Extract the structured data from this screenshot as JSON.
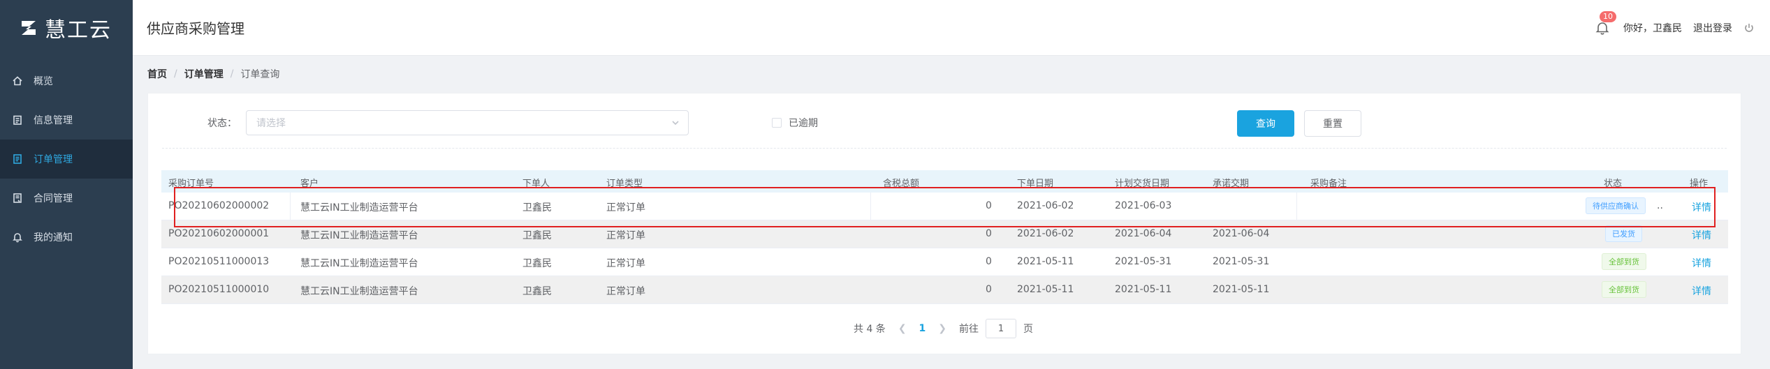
{
  "app": {
    "logo_text": "慧工云"
  },
  "sidebar": {
    "items": [
      {
        "label": "概览",
        "icon": "home-icon"
      },
      {
        "label": "信息管理",
        "icon": "clipboard-icon"
      },
      {
        "label": "订单管理",
        "icon": "order-icon",
        "active": true
      },
      {
        "label": "合同管理",
        "icon": "contract-icon"
      },
      {
        "label": "我的通知",
        "icon": "bell-icon"
      }
    ]
  },
  "header": {
    "title": "供应商采购管理",
    "notification_count": "10",
    "greeting": "你好，卫鑫民",
    "logout_label": "退出登录"
  },
  "breadcrumb": {
    "home": "首页",
    "section": "订单管理",
    "current": "订单查询",
    "separator": "/"
  },
  "filters": {
    "status_label": "状态：",
    "status_placeholder": "请选择",
    "overdue_label": "已逾期",
    "query_button": "查询",
    "reset_button": "重置"
  },
  "table": {
    "columns": [
      "采购订单号",
      "客户",
      "下单人",
      "订单类型",
      "含税总额",
      "下单日期",
      "计划交货日期",
      "承诺交期",
      "采购备注",
      "状态",
      "操作"
    ],
    "rows": [
      {
        "po": "PO20210602000002",
        "customer": "慧工云IN工业制造运营平台",
        "orderer": "卫鑫民",
        "type": "正常订单",
        "total": "0",
        "order_date": "2021-06-02",
        "planned_date": "2021-06-03",
        "promised_date": "",
        "remark": "",
        "status": "待供应商确认",
        "status_color": "blue",
        "action": "详情"
      },
      {
        "po": "PO20210602000001",
        "customer": "慧工云IN工业制造运营平台",
        "orderer": "卫鑫民",
        "type": "正常订单",
        "total": "0",
        "order_date": "2021-06-02",
        "planned_date": "2021-06-04",
        "promised_date": "2021-06-04",
        "remark": "",
        "status": "已发货",
        "status_color": "blue",
        "action": "详情"
      },
      {
        "po": "PO20210511000013",
        "customer": "慧工云IN工业制造运营平台",
        "orderer": "卫鑫民",
        "type": "正常订单",
        "total": "0",
        "order_date": "2021-05-11",
        "planned_date": "2021-05-31",
        "promised_date": "2021-05-31",
        "remark": "",
        "status": "全部到货",
        "status_color": "green",
        "action": "详情"
      },
      {
        "po": "PO20210511000010",
        "customer": "慧工云IN工业制造运营平台",
        "orderer": "卫鑫民",
        "type": "正常订单",
        "total": "0",
        "order_date": "2021-05-11",
        "planned_date": "2021-05-11",
        "promised_date": "2021-05-11",
        "remark": "",
        "status": "全部到货",
        "status_color": "green",
        "action": "详情"
      }
    ]
  },
  "pagination": {
    "total_text": "共 4 条",
    "current_page": "1",
    "goto_label": "前往",
    "goto_value": "1",
    "page_suffix": "页"
  },
  "colors": {
    "accent": "#1aa3df",
    "sidebar_bg": "#2c3e50",
    "highlight": "#e02020"
  }
}
